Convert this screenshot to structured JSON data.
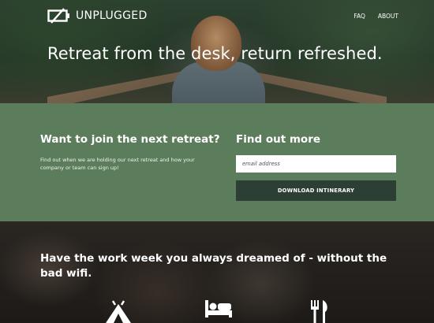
{
  "brand": {
    "name": "UNPLUGGED",
    "logo_icon": "battery-slash-icon"
  },
  "nav": {
    "items": [
      {
        "label": "FAQ"
      },
      {
        "label": "ABOUT"
      }
    ]
  },
  "hero": {
    "title": "Retreat from the desk, return refreshed."
  },
  "join": {
    "heading": "Want to join the next retreat?",
    "text": "Find out when we are holding our next retreat and how your company or team can sign up!"
  },
  "signup": {
    "heading": "Find out more",
    "email_placeholder": "email address",
    "button_label": "DOWNLOAD INTINERARY"
  },
  "features": {
    "heading": "Have the work week you always dreamed of - without the bad wifi.",
    "icons": [
      "campsite-icon",
      "bed-icon",
      "utensils-icon"
    ]
  },
  "colors": {
    "band": "#5c7d5c",
    "button": "#2c3f34",
    "text": "#ffffff"
  }
}
